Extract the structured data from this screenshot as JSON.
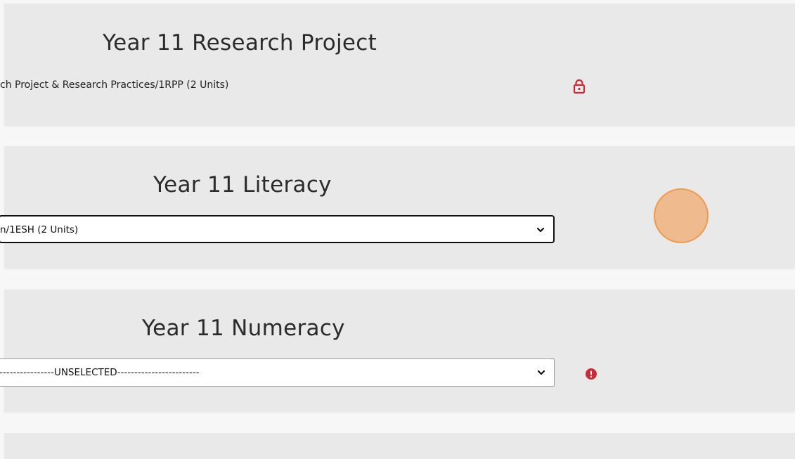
{
  "sections": {
    "research_project": {
      "title": "Year 11 Research Project",
      "subject_text": "ch Project & Research Practices/1RPP (2 Units)",
      "status_icon": "lock-icon"
    },
    "literacy": {
      "title": "Year 11 Literacy",
      "selected_value": "n/1ESH (2 Units)"
    },
    "numeracy": {
      "title": "Year 11 Numeracy",
      "selected_value": "----------------UNSELECTED------------------------",
      "status_icon": "alert-icon"
    }
  },
  "colors": {
    "card_bg": "#e9e9e9",
    "page_bg": "#f7f7f7",
    "lock_red": "#cc2a36",
    "alert_red": "#cc2a36",
    "cursor_orange": "#f0aa6e"
  }
}
